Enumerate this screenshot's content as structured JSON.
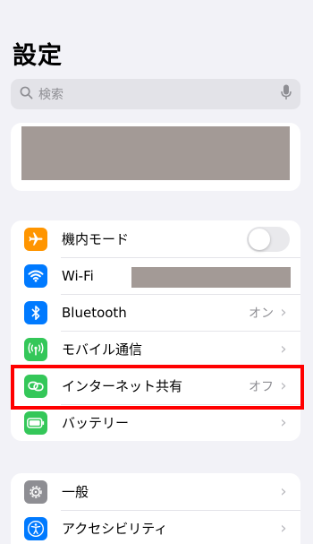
{
  "header": {
    "title": "設定"
  },
  "search": {
    "placeholder": "検索",
    "icon": "search-icon",
    "mic_icon": "microphone-icon"
  },
  "groups": [
    {
      "items": [
        {
          "label": "機内モード",
          "icon": "airplane-icon",
          "icon_color": "#ff9500",
          "control": "toggle",
          "toggle_on": false
        },
        {
          "label": "Wi-Fi",
          "icon": "wifi-icon",
          "icon_color": "#007aff",
          "value_redacted": true
        },
        {
          "label": "Bluetooth",
          "icon": "bluetooth-icon",
          "icon_color": "#007aff",
          "value": "オン"
        },
        {
          "label": "モバイル通信",
          "icon": "antenna-icon",
          "icon_color": "#34c759",
          "value": ""
        },
        {
          "label": "インターネット共有",
          "icon": "hotspot-chain-icon",
          "icon_color": "#34c759",
          "value": "オフ",
          "highlighted": true
        },
        {
          "label": "バッテリー",
          "icon": "battery-icon",
          "icon_color": "#34c759",
          "value": ""
        }
      ]
    },
    {
      "items": [
        {
          "label": "一般",
          "icon": "gear-icon",
          "icon_color": "#8e8e93",
          "value": ""
        },
        {
          "label": "アクセシビリティ",
          "icon": "accessibility-icon",
          "icon_color": "#007aff",
          "value": ""
        }
      ]
    }
  ],
  "colors": {
    "background": "#f2f2f7",
    "highlight": "#ff0000",
    "redaction": "#a39a96"
  }
}
